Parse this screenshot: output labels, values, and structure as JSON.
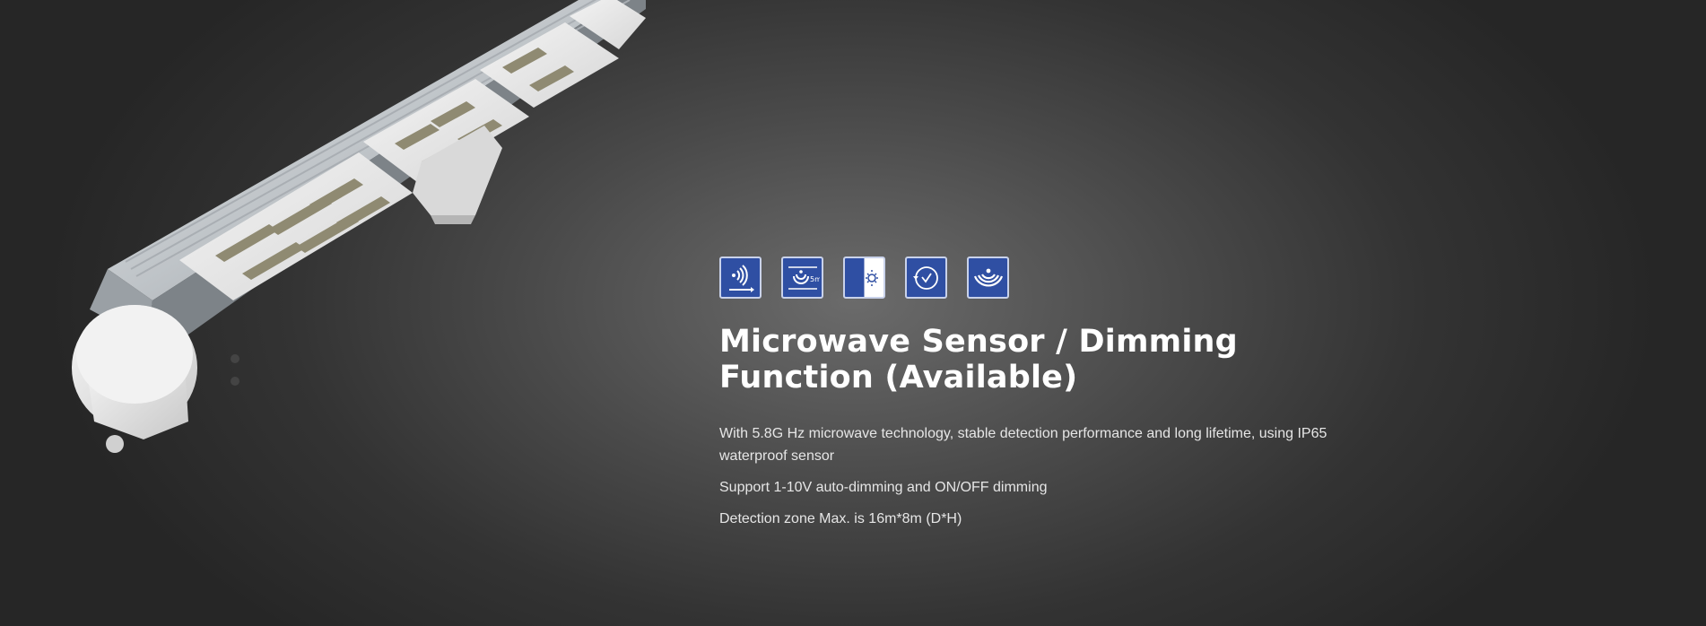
{
  "product_image": {
    "icon": "led-linear-light-with-microwave-sensor-image"
  },
  "features": {
    "icons": [
      {
        "name": "microwave-wave-icon"
      },
      {
        "name": "detection-height-icon",
        "label": "5m"
      },
      {
        "name": "day-night-icon"
      },
      {
        "name": "timer-icon"
      },
      {
        "name": "sensor-wave-icon"
      }
    ],
    "title": "Microwave Sensor / Dimming Function (Available)",
    "paragraphs": [
      "With 5.8G Hz microwave technology, stable detection performance and long lifetime, using IP65 waterproof sensor",
      "Support 1-10V auto-dimming and ON/OFF dimming",
      "Detection zone Max. is 16m*8m (D*H)"
    ]
  },
  "colors": {
    "icon_background": "#2f4fa3",
    "icon_border": "#c9d2ea",
    "text": "#f2f2f2"
  }
}
